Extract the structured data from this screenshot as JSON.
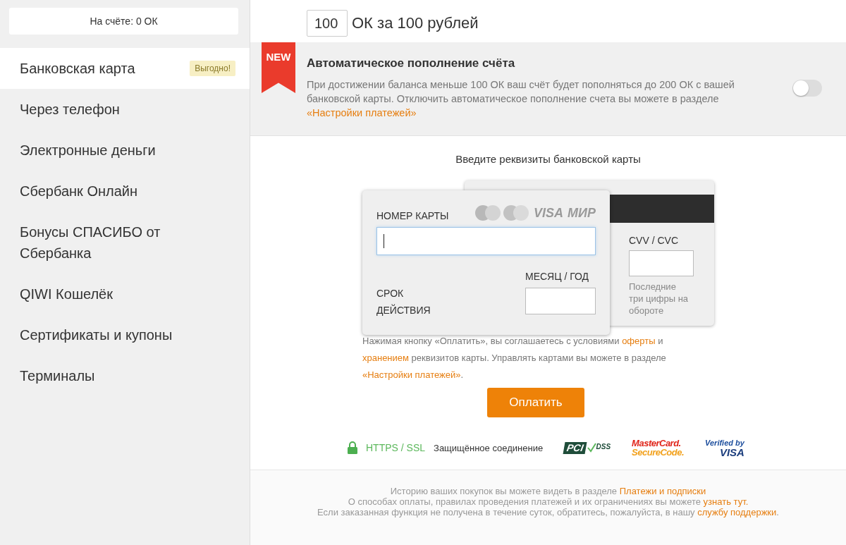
{
  "sidebar": {
    "balance": "На счёте: 0 ОК",
    "items": [
      {
        "label": "Банковская карта",
        "selected": true,
        "badge": "Выгодно!"
      },
      {
        "label": "Через телефон",
        "selected": false
      },
      {
        "label": "Электронные деньги",
        "selected": false
      },
      {
        "label": "Сбербанк Онлайн",
        "selected": false
      },
      {
        "label": "Бонусы СПАСИБО от Сбербанка",
        "selected": false
      },
      {
        "label": "QIWI Кошелёк",
        "selected": false
      },
      {
        "label": "Сертификаты и купоны",
        "selected": false
      },
      {
        "label": "Терминалы",
        "selected": false
      }
    ]
  },
  "amount": {
    "value": "100",
    "label": "ОК за 100 рублей"
  },
  "autopay": {
    "ribbon": "NEW",
    "title": "Автоматическое пополнение счёта",
    "on": false,
    "description": [
      {
        "text": "При достижении баланса меньше 100 ОК ваш счёт будет пополняться до 200 ОК с вашей банковской карты. Отключить автоматическое пополнение счета вы можете в разделе ",
        "kind": "text"
      },
      {
        "text": "«Настройки платежей»",
        "kind": "link"
      }
    ]
  },
  "card_form": {
    "heading": "Введите реквизиты банковской карты",
    "number_label": "НОМЕР КАРТЫ",
    "brands": [
      "VISA",
      "МИР"
    ],
    "expiry_label": "СРОК ДЕЙСТВИЯ",
    "month_year_label": "МЕСЯЦ / ГОД",
    "cvv_label": "CVV / CVC",
    "cvv_hint": "Последние три цифры на обороте"
  },
  "terms": [
    {
      "text": "Нажимая кнопку «Оплатить», вы соглашаетесь с условиями ",
      "kind": "text"
    },
    {
      "text": "оферты",
      "kind": "link"
    },
    {
      "text": " и ",
      "kind": "text"
    },
    {
      "text": "хранением",
      "kind": "link"
    },
    {
      "text": " реквизитов карты. Управлять картами вы можете в разделе ",
      "kind": "text"
    },
    {
      "text": "«Настройки платежей»",
      "kind": "link"
    },
    {
      "text": ".",
      "kind": "text"
    }
  ],
  "pay_button": "Оплатить",
  "security": {
    "protocol": "HTTPS / SSL",
    "label": "Защищённое соединение",
    "logos": [
      {
        "kind": "pci",
        "lines": [
          "PCI",
          "DSS"
        ]
      },
      {
        "kind": "mastercard",
        "lines": [
          "MasterCard.",
          "SecureCode."
        ]
      },
      {
        "kind": "visa",
        "lines": [
          "Verified by",
          "VISA"
        ]
      }
    ]
  },
  "footer": [
    [
      {
        "text": "Историю ваших покупок вы можете видеть в разделе ",
        "kind": "text"
      },
      {
        "text": "Платежи и подписки",
        "kind": "link"
      }
    ],
    [
      {
        "text": "О способах оплаты, правилах проведения платежей и их ограничениях вы можете ",
        "kind": "text"
      },
      {
        "text": "узнать тут.",
        "kind": "link"
      }
    ],
    [
      {
        "text": "Если заказанная функция не получена в течение суток, обратитесь, пожалуйста, в нашу ",
        "kind": "text"
      },
      {
        "text": "службу поддержки",
        "kind": "link"
      },
      {
        "text": ".",
        "kind": "text"
      }
    ]
  ]
}
